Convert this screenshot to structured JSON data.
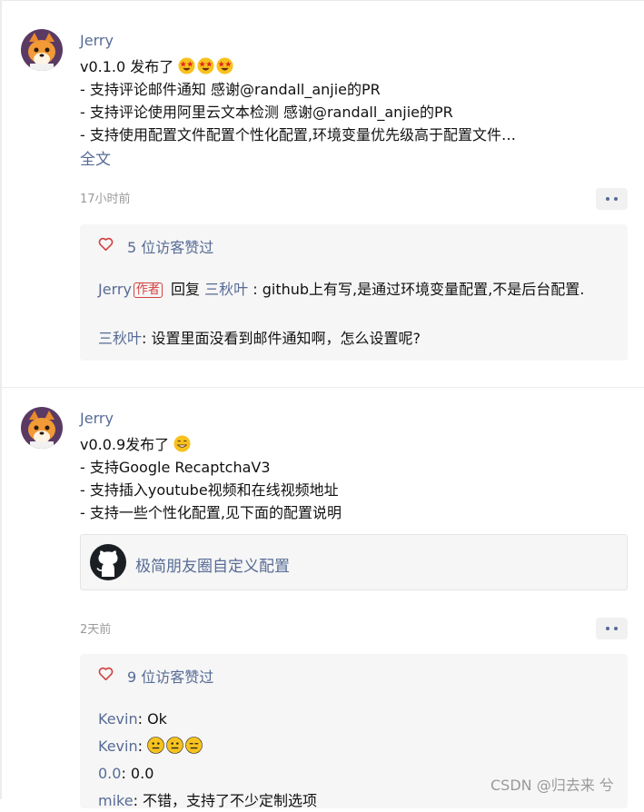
{
  "posts": [
    {
      "author": "Jerry",
      "lines": [
        "v0.1.0 发布了",
        "- 支持评论邮件通知 感谢@randall_anjie的PR",
        "- 支持评论使用阿里云文本检测 感谢@randall_anjie的PR",
        "- 支持使用配置文件配置个性化配置,环境变量优先级高于配置文件…"
      ],
      "emoji_icons": [
        "star-struck-emoji-icon",
        "star-struck-emoji-icon",
        "star-struck-emoji-icon"
      ],
      "full_text_link": "全文",
      "time": "17小时前",
      "likes": "5 位访客赞过",
      "comments": [
        {
          "name": "Jerry",
          "tag": "作者",
          "reply_word": "回复",
          "reply_to": "三秋叶",
          "text": ": github上有写,是通过环境变量配置,不是后台配置."
        },
        {
          "name": "三秋叶",
          "text": ": 设置里面没看到邮件通知啊，怎么设置呢?"
        }
      ]
    },
    {
      "author": "Jerry",
      "lines": [
        "v0.0.9发布了",
        "- 支持Google RecaptchaV3",
        "- 支持插入youtube视频和在线视频地址",
        "- 支持一些个性化配置,见下面的配置说明"
      ],
      "emoji_icons": [
        "grinning-emoji-icon"
      ],
      "link_card": {
        "title": "极简朋友圈自定义配置",
        "icon": "github-icon"
      },
      "time": "2天前",
      "likes": "9 位访客赞过",
      "comments": [
        {
          "name": "Kevin",
          "text": ": Ok"
        },
        {
          "name": "Kevin",
          "text": ":"
        },
        {
          "name": "0.0",
          "text": ": 0.0"
        },
        {
          "name": "mike",
          "text": ": 不错，支持了不少定制选项"
        }
      ],
      "comment_emoji_icons": [
        "neutral-face-emoji-icon",
        "neutral-face-emoji-icon",
        "expressionless-face-emoji-icon"
      ]
    }
  ],
  "watermark": "CSDN @归去来 兮",
  "colors": {
    "link": "#576b95",
    "heart": "#d2423f",
    "box_bg": "#f6f6f6"
  }
}
